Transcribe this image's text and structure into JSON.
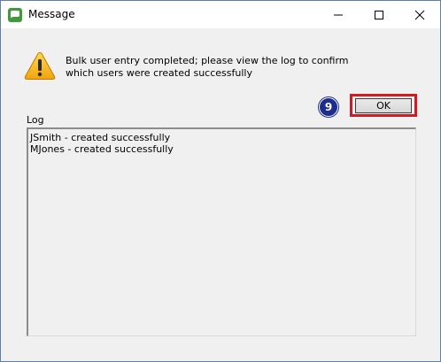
{
  "window": {
    "title": "Message",
    "app_icon": "app-logo-icon",
    "controls": {
      "minimize_icon": "minimize-icon",
      "maximize_icon": "maximize-icon",
      "close_icon": "close-icon"
    }
  },
  "dialog": {
    "icon": "warning-icon",
    "message_line1": "Bulk user entry completed; please view the log to confirm",
    "message_line2": "which users were created successfully",
    "step_badge": "9",
    "ok_label": "OK",
    "highlight_color": "#d11a22",
    "badge_color": "#1d2c8f"
  },
  "log": {
    "label": "Log",
    "lines": [
      "JSmith - created successfully",
      "MJones - created successfully"
    ]
  }
}
